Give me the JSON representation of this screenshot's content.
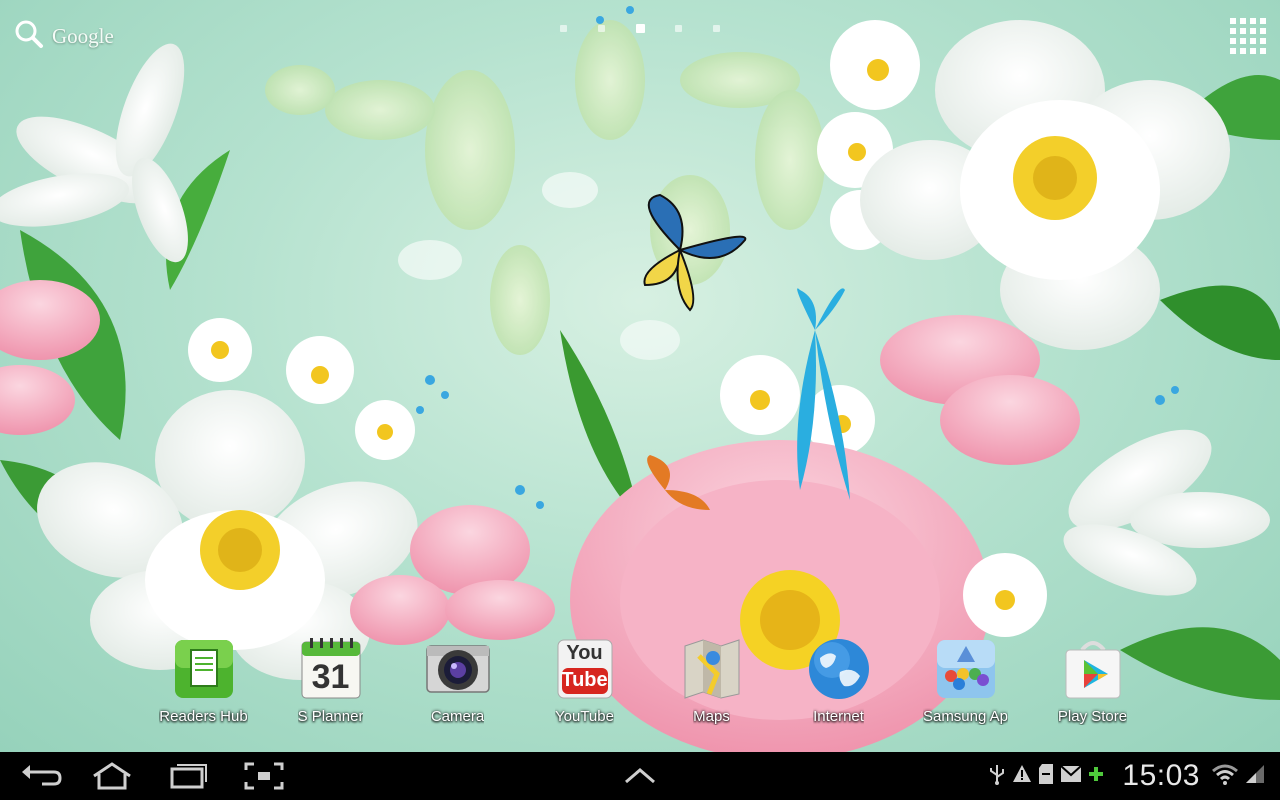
{
  "search": {
    "label": "Google",
    "icon": "search-icon"
  },
  "home_pages": {
    "count": 5,
    "active_index": 2
  },
  "apps_button": {
    "icon": "apps-grid-icon"
  },
  "dock": {
    "apps": [
      {
        "label": "Readers Hub",
        "icon": "readers-hub-icon"
      },
      {
        "label": "S Planner",
        "icon": "calendar-icon",
        "badge": "31"
      },
      {
        "label": "Camera",
        "icon": "camera-icon"
      },
      {
        "label": "YouTube",
        "icon": "youtube-icon",
        "badge_top": "You",
        "badge_bottom": "Tube"
      },
      {
        "label": "Maps",
        "icon": "maps-icon"
      },
      {
        "label": "Internet",
        "icon": "globe-icon"
      },
      {
        "label": "Samsung Ap",
        "icon": "samsung-apps-icon"
      },
      {
        "label": "Play Store",
        "icon": "play-store-icon"
      }
    ]
  },
  "system_bar": {
    "nav": [
      "back-icon",
      "home-icon",
      "recent-apps-icon",
      "screenshot-icon",
      "up-arrow-icon"
    ],
    "time": "15:03",
    "status_icons": [
      "usb-icon",
      "warning-icon",
      "sd-card-icon",
      "gmail-icon",
      "battery-plus-icon",
      "wifi-icon",
      "signal-icon"
    ]
  },
  "colors": {
    "wallpaper": "#b5e2cf",
    "system_bar": "#000000",
    "clock": "#e8e8e8"
  }
}
